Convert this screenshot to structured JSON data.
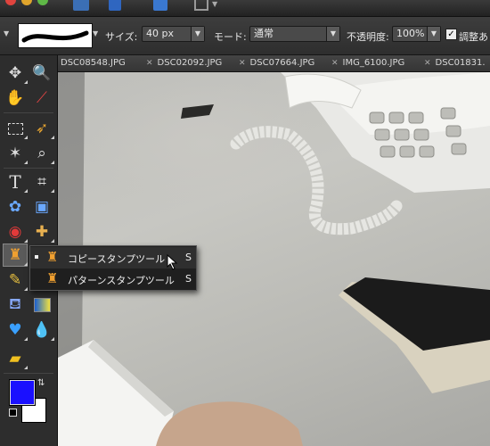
{
  "options_bar": {
    "size_label": "サイズ:",
    "size_value": "40 px",
    "mode_label": "モード:",
    "mode_value": "通常",
    "opacity_label": "不透明度:",
    "opacity_value": "100%",
    "adjust_label": "調整あ",
    "adjust_checked": true
  },
  "tabs": [
    {
      "label": "DSC08548.JPG"
    },
    {
      "label": "DSC02092.JPG"
    },
    {
      "label": "DSC07664.JPG"
    },
    {
      "label": "IMG_6100.JPG"
    },
    {
      "label": "DSC01831."
    }
  ],
  "tools": [
    {
      "icon": "move-icon"
    },
    {
      "icon": "zoom-icon"
    },
    {
      "icon": "hand-icon"
    },
    {
      "icon": "eyedropper-icon"
    },
    {
      "icon": "rectangular-marquee-icon"
    },
    {
      "icon": "lasso-icon"
    },
    {
      "icon": "magic-wand-icon"
    },
    {
      "icon": "selection-brush-icon"
    },
    {
      "icon": "type-icon"
    },
    {
      "icon": "crop-icon"
    },
    {
      "icon": "custom-shape-icon"
    },
    {
      "icon": "recompose-icon"
    },
    {
      "icon": "red-eye-icon"
    },
    {
      "icon": "healing-brush-icon"
    },
    {
      "icon": "clone-stamp-icon"
    },
    {
      "icon": "brush-icon"
    },
    {
      "icon": "eraser-icon"
    },
    {
      "icon": "paint-bucket-icon"
    },
    {
      "icon": "gradient-icon"
    },
    {
      "icon": "shape-icon"
    },
    {
      "icon": "blur-icon"
    },
    {
      "icon": "sponge-icon"
    }
  ],
  "flyout": {
    "items": [
      {
        "label": "コピースタンプツール",
        "shortcut": "S",
        "icon": "clone-stamp-icon",
        "selected": true
      },
      {
        "label": "パターンスタンプツール",
        "shortcut": "S",
        "icon": "pattern-stamp-icon",
        "selected": false
      }
    ]
  },
  "colors": {
    "foreground": "#1a10ff",
    "background": "#ffffff",
    "window_bg": "#2b2b2b"
  }
}
